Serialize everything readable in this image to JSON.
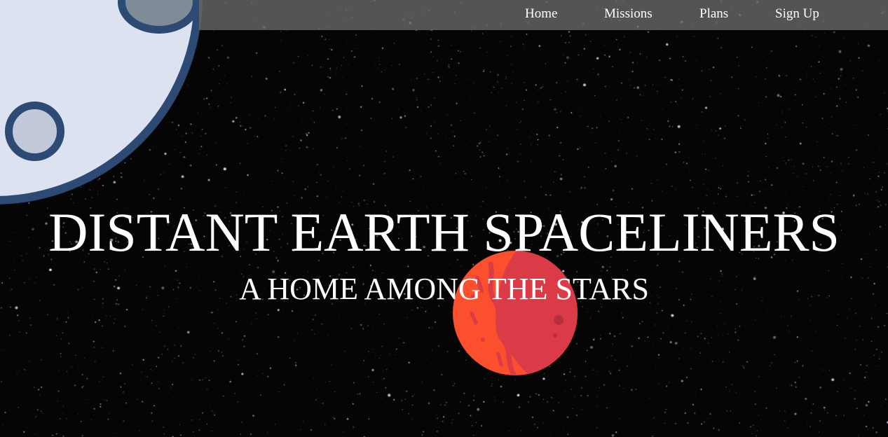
{
  "nav": {
    "items": [
      {
        "label": "Home"
      },
      {
        "label": "Missions"
      },
      {
        "label": "Plans"
      },
      {
        "label": "Sign Up"
      }
    ]
  },
  "hero": {
    "title": "DISTANT EARTH SPACELINERS",
    "subtitle": "A HOME AMONG THE STARS"
  },
  "colors": {
    "background": "#050505",
    "nav_bar": "#666666",
    "text": "#ffffff",
    "moon_surface": "#dde2f1",
    "moon_outline": "#2c4a74",
    "planet_light": "#fb4f2e",
    "planet_dark": "#da3b46"
  },
  "icons": {
    "moon": "moon-illustration",
    "planet": "mars-planet-illustration"
  }
}
